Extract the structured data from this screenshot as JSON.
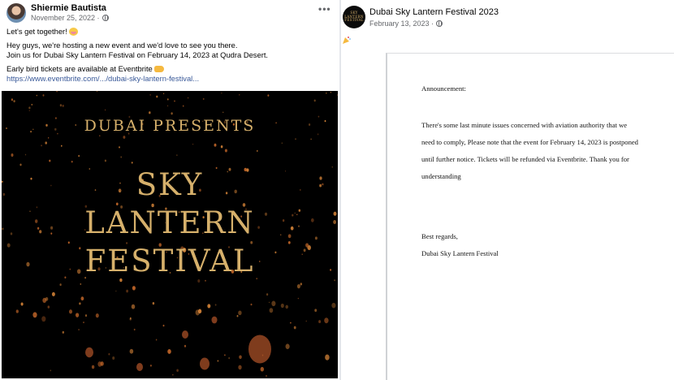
{
  "left_post": {
    "author": "Shiermie Bautista",
    "date": "November 25, 2022 ·",
    "more": "•••",
    "line1": "Let's get together!",
    "line2": "Hey guys, we're hosting a new event and we'd love to see you there.",
    "line3": "Join us for Dubai Sky Lantern Festival on February 14, 2023 at Qudra Desert.",
    "line4": "Early bird tickets are available at Eventbrite",
    "link": "https://www.eventbrite.com/.../dubai-sky-lantern-festival...",
    "poster": {
      "presents": "DUBAI PRESENTS",
      "title_1": "SKY",
      "title_2": "LANTERN",
      "title_3": "FESTIVAL"
    }
  },
  "right_post": {
    "author": "Dubai Sky Lantern Festival 2023",
    "date": "February 13, 2023 ·",
    "avatar_text": [
      "SKY",
      "LANTERN",
      "FESTIVAL"
    ],
    "doc": {
      "heading": "Announcement:",
      "body": "There's some last minute issues concerned with aviation authority that we need to comply, Please note that the event for February 14, 2023 is postponed until further notice. Tickets will be refunded via Eventbrite. Thank you for understanding",
      "regards": "Best regards,",
      "org": "Dubai Sky Lantern Festival"
    }
  },
  "icons": {
    "globe": "globe-icon",
    "hug_emoji": "hugging-face-icon",
    "pointing_hand": "pointing-hand-icon",
    "party": "party-popper-icon"
  },
  "colors": {
    "link": "#385898",
    "poster_gold": "#d6b06b",
    "meta_gray": "#65676b"
  }
}
